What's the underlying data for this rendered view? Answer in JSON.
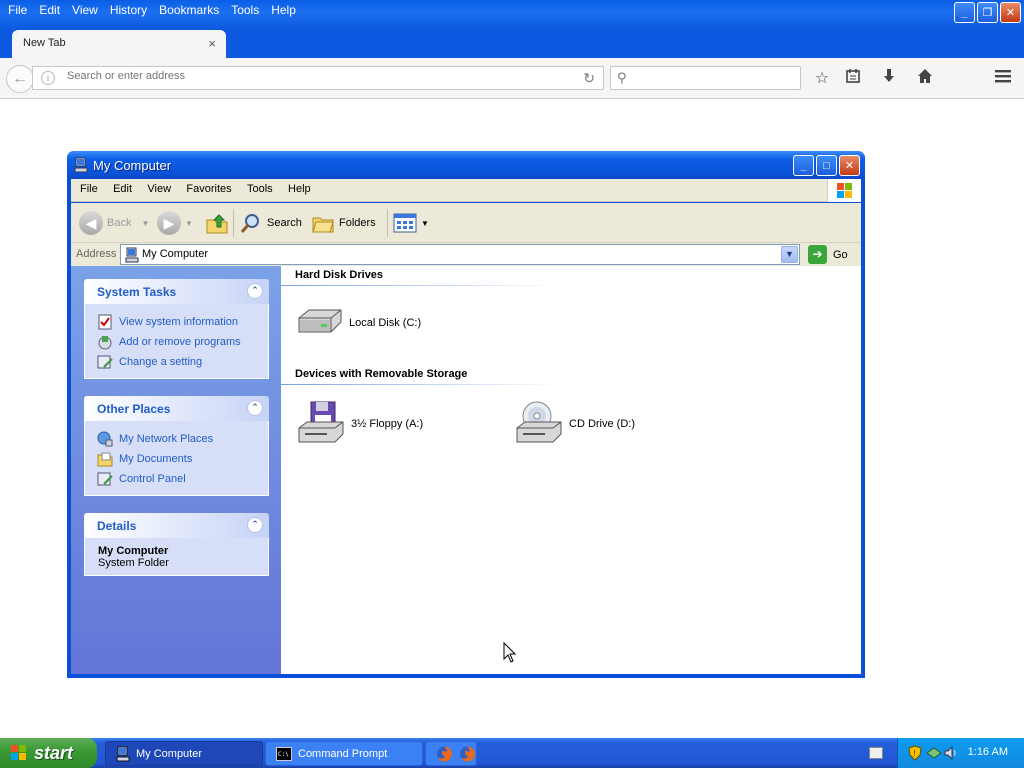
{
  "firefox": {
    "menu": [
      "File",
      "Edit",
      "View",
      "History",
      "Bookmarks",
      "Tools",
      "Help"
    ],
    "tab_title": "New Tab",
    "tab_close": "×",
    "url_placeholder": "Search or enter address",
    "search_placeholder": "",
    "window_controls": [
      "minimize",
      "restore",
      "close"
    ]
  },
  "explorer": {
    "title": "My Computer",
    "menu": [
      "File",
      "Edit",
      "View",
      "Favorites",
      "Tools",
      "Help"
    ],
    "toolbar": {
      "back_label": "Back",
      "search_label": "Search",
      "folders_label": "Folders"
    },
    "address": {
      "label": "Address",
      "value": "My Computer",
      "go_label": "Go"
    },
    "tasks": {
      "system": {
        "title": "System Tasks",
        "items": [
          "View system information",
          "Add or remove programs",
          "Change a setting"
        ]
      },
      "other": {
        "title": "Other Places",
        "items": [
          "My Network Places",
          "My Documents",
          "Control Panel"
        ]
      },
      "details": {
        "title": "Details",
        "name": "My Computer",
        "type": "System Folder"
      }
    },
    "groups": {
      "hdd": {
        "title": "Hard Disk Drives",
        "items": [
          "Local Disk (C:)"
        ]
      },
      "removable": {
        "title": "Devices with Removable Storage",
        "items": [
          "3½ Floppy (A:)",
          "CD Drive (D:)"
        ]
      }
    }
  },
  "taskbar": {
    "start_label": "start",
    "tasks": [
      "My Computer",
      "Command Prompt"
    ],
    "clock": "1:16 AM"
  },
  "colors": {
    "xp_blue": "#0a53d8",
    "task_pane_link": "#215dc6",
    "start_green": "#3c9a36"
  }
}
